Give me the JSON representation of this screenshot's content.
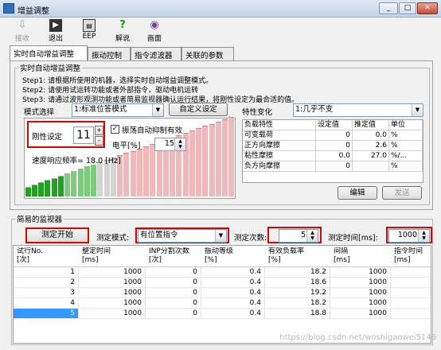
{
  "window": {
    "title": "增益调整",
    "controls": [
      "_",
      "□",
      "✕"
    ]
  },
  "toolbar": {
    "items": [
      {
        "label": "接收",
        "icon": "receive-icon",
        "enabled": false
      },
      {
        "label": "退出",
        "icon": "exit-icon",
        "enabled": true
      },
      {
        "label": "EEP",
        "icon": "eep-write-icon",
        "enabled": true
      },
      {
        "label": "解说",
        "icon": "help-icon",
        "enabled": true
      },
      {
        "label": "画面",
        "icon": "camera-icon",
        "enabled": true
      }
    ]
  },
  "tabs": [
    "实时自动增益调整",
    "振动控制",
    "指令滤波器",
    "关联的参数"
  ],
  "auto_tuning": {
    "group_title": "实时自动增益调整",
    "steps": [
      "Step1: 请根据所使用的机器，选择实时自动增益调整模式。",
      "Step2: 请使用试运转功能或者外部指令，驱动电机运转",
      "Step3: 请通过波形观测功能或者简易监视器确认运行结果，将刚性设定为最合适的值。"
    ],
    "mode_label": "模式选择",
    "mode_value": "1:标准位答模式",
    "custom_button": "自定义设定",
    "rigidity_label": "刚性设定",
    "rigidity_value": "11",
    "spin_up": "+",
    "spin_down": "-",
    "vib_check_label": "振荡自动抑制有效",
    "vib_checked": true,
    "level_label": "电平[%]",
    "level_value": "15",
    "speed_label": "速度响应频率= 18.0  [Hz]",
    "bar_level": 11,
    "bar_count": 32
  },
  "characteristics": {
    "label": "特性变化",
    "select_value": "1:几乎不变",
    "headers": [
      "负载特性",
      "设定值",
      "推定值",
      "单位"
    ],
    "rows": [
      [
        "可变载荷",
        "0",
        "0.0",
        "%"
      ],
      [
        "正方向摩擦",
        "0",
        "2.6",
        "%"
      ],
      [
        "粘性摩擦",
        "0.0",
        "27.0",
        "%/..."
      ],
      [
        "负方向摩擦",
        "0",
        "",
        "%"
      ]
    ],
    "edit_button": "编辑",
    "send_button": "发送"
  },
  "monitor": {
    "group_title": "简易的监视器",
    "start_button": "测定开始",
    "mode_label": "测定模式:",
    "mode_value": "有位置指令",
    "count_label": "测定次数:",
    "count_value": "5",
    "time_label": "测定时间[ms]:",
    "time_value": "1000",
    "headers": [
      [
        "试行No.",
        "[次]"
      ],
      [
        "整定时间",
        "[ms]"
      ],
      [
        "INP分割次数",
        "[次]"
      ],
      [
        "振动等级",
        "[%]"
      ],
      [
        "有效负载率",
        "[%]"
      ],
      [
        "间隔",
        "[ms]"
      ],
      [
        "指令时间",
        "[ms]"
      ]
    ],
    "rows": [
      [
        "1",
        "1000",
        "0",
        "0.4",
        "18.2",
        "1000",
        ""
      ],
      [
        "2",
        "1000",
        "0",
        "0.4",
        "18.6",
        "1000",
        ""
      ],
      [
        "3",
        "1000",
        "0",
        "0.4",
        "19.2",
        "1000",
        ""
      ],
      [
        "4",
        "1000",
        "0",
        "0.4",
        "18.2",
        "1000",
        ""
      ],
      [
        "5",
        "1000",
        "0",
        "0.4",
        "18.8",
        "1000",
        ""
      ]
    ],
    "selected_row": 4
  },
  "watermark": "https://blog.csdn.net/woshigaowei5146",
  "colors": {
    "highlight_red": "#e00000",
    "bar_green": "#22a022",
    "bar_grey": "#d4d4d4",
    "bar_pink": "#f0b8b8",
    "selected": "#3399ff"
  }
}
